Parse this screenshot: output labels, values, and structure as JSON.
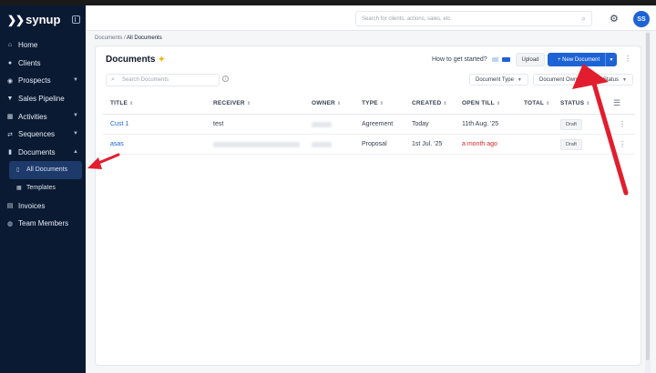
{
  "app": {
    "logo": "synup"
  },
  "topbar": {
    "search_placeholder": "Search for clients, actions, sales, etc",
    "avatar_initials": "SS"
  },
  "sidebar": {
    "items": [
      {
        "label": "Home",
        "icon": "home-icon"
      },
      {
        "label": "Clients",
        "icon": "user-icon"
      },
      {
        "label": "Prospects",
        "icon": "person-icon",
        "expandable": true
      },
      {
        "label": "Sales Pipeline",
        "icon": "funnel-icon"
      },
      {
        "label": "Activities",
        "icon": "calendar-icon",
        "expandable": true
      },
      {
        "label": "Sequences",
        "icon": "sequence-icon",
        "expandable": true
      },
      {
        "label": "Documents",
        "icon": "document-icon",
        "expanded": true
      },
      {
        "label": "All Documents",
        "icon": "doc-small-icon",
        "sub": true,
        "active": true
      },
      {
        "label": "Templates",
        "icon": "grid-icon",
        "sub": true
      },
      {
        "label": "Invoices",
        "icon": "invoice-icon"
      },
      {
        "label": "Team Members",
        "icon": "team-icon"
      }
    ]
  },
  "breadcrumb": {
    "parent": "Documents",
    "separator": " / ",
    "current": "All Documents"
  },
  "page": {
    "title": "Documents",
    "how_to": "How to get started?",
    "upload_label": "Upload",
    "new_label": "+ New Document",
    "search_placeholder": "Search Documents",
    "filters": [
      "Document Type",
      "Document Owner",
      "Status"
    ]
  },
  "table": {
    "headers": [
      "TITLE",
      "RECEIVER",
      "OWNER",
      "TYPE",
      "CREATED",
      "OPEN TILL",
      "TOTAL",
      "STATUS"
    ],
    "rows": [
      {
        "title": "Cust 1",
        "receiver": "test",
        "type": "Agreement",
        "created": "Today",
        "open_till": "11th Aug. '25",
        "status": "Draft"
      },
      {
        "title": "asas",
        "receiver": "",
        "type": "Proposal",
        "created": "1st Jul. '25",
        "open_till": "a month ago",
        "status": "Draft"
      }
    ]
  },
  "colors": {
    "sidebar_bg": "#0b1a33",
    "primary": "#1e63d6",
    "annotation": "#e11d2e",
    "overdue": "#dc2626"
  }
}
